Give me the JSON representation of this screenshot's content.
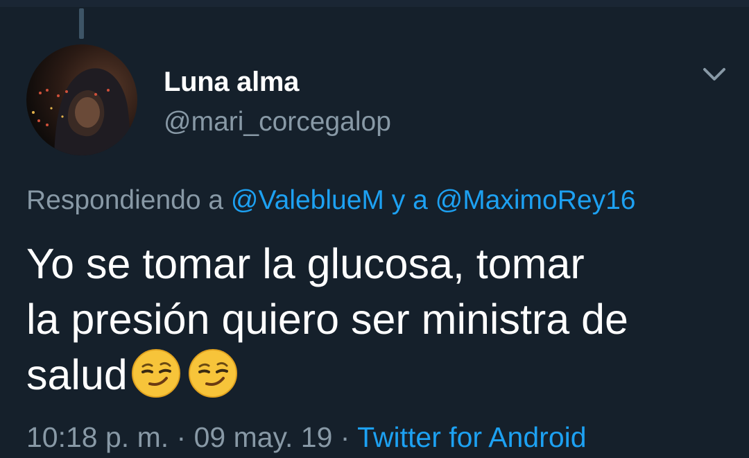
{
  "tweet": {
    "author": {
      "display_name": "Luna alma",
      "handle": "@mari_corcegalop"
    },
    "replying_prefix": "Respondiendo a",
    "reply_to": [
      "@ValeblueM",
      "@MaximoRey16"
    ],
    "reply_conjunction": "y a",
    "text_lines": [
      "Yo se tomar la glucosa, tomar",
      "la presión quiero ser ministra de",
      "salud"
    ],
    "emojis": [
      "smirking-face",
      "smirking-face"
    ],
    "time": "10:18 p. m.",
    "separator": "·",
    "date": "09 may. 19",
    "source": "Twitter for Android"
  },
  "icons": {
    "menu": "chevron-down-icon"
  },
  "colors": {
    "background": "#15202b",
    "text_primary": "#ffffff",
    "text_secondary": "#8899a6",
    "link": "#1da1f2"
  }
}
